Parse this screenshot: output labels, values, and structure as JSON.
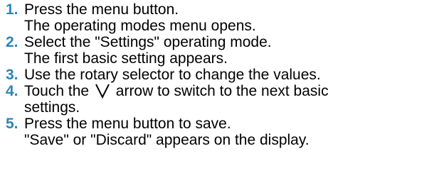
{
  "colors": {
    "step_number": "#2a86b8",
    "text": "#000000"
  },
  "steps": [
    {
      "number": "1.",
      "lines": [
        "Press the menu button.",
        "The operating modes menu opens."
      ]
    },
    {
      "number": "2.",
      "lines": [
        "Select the \"Settings\" operating mode.",
        "The first basic setting appears."
      ]
    },
    {
      "number": "3.",
      "lines": [
        "Use the rotary selector to change the values."
      ]
    },
    {
      "number": "4.",
      "line1_before": "Touch the",
      "icon": "chevron-down-icon",
      "line1_after": "arrow to switch to the next basic",
      "line2": "settings."
    },
    {
      "number": "5.",
      "lines": [
        "Press the menu button to save.",
        "\"Save\" or \"Discard\" appears on the display."
      ]
    }
  ]
}
